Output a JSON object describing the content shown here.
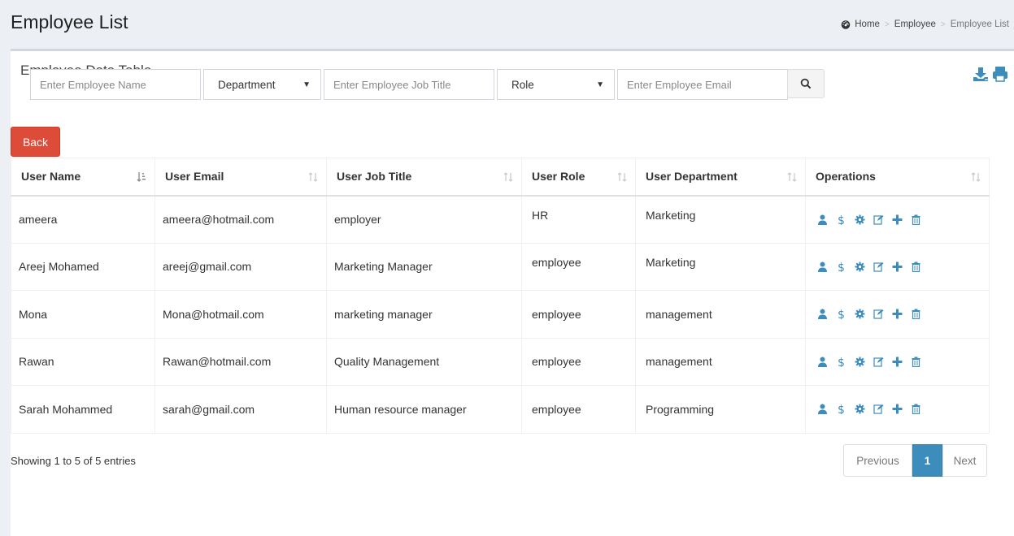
{
  "header": {
    "title": "Employee List",
    "breadcrumb": {
      "home": "Home",
      "section": "Employee",
      "current": "Employee List",
      "sep": ">"
    }
  },
  "box": {
    "title": "Employee Data Table"
  },
  "filters": {
    "name_placeholder": "Enter Employee Name",
    "department": "Department",
    "job_placeholder": "Enter Employee Job Title",
    "role": "Role",
    "email_placeholder": "Enter Employee Email",
    "caret": "▼"
  },
  "back_label": "Back",
  "table": {
    "columns": [
      "User Name",
      "User Email",
      "User Job Title",
      "User Role",
      "User Department",
      "Operations"
    ],
    "rows": [
      [
        "ameera",
        "ameera@hotmail.com",
        "employer",
        "HR",
        "Marketing"
      ],
      [
        "Areej Mohamed",
        "areej@gmail.com",
        "Marketing Manager",
        "employee",
        "Marketing"
      ],
      [
        "Mona",
        "Mona@hotmail.com",
        "marketing manager",
        "employee",
        "management"
      ],
      [
        "Rawan",
        "Rawan@hotmail.com",
        "Quality Management",
        "employee",
        "management"
      ],
      [
        "Sarah Mohammed",
        "sarah@gmail.com",
        "Human resource manager",
        "employee",
        "Programming"
      ]
    ],
    "operation_icons": [
      "user-icon",
      "dollar-icon",
      "gear-icon",
      "edit-icon",
      "plus-icon",
      "trash-icon"
    ]
  },
  "footer": {
    "info": "Showing 1 to 5 of 5 entries",
    "pager": {
      "previous": "Previous",
      "page": "1",
      "next": "Next"
    }
  },
  "colors": {
    "accent": "#3c8dbc",
    "danger": "#dd4b39"
  }
}
